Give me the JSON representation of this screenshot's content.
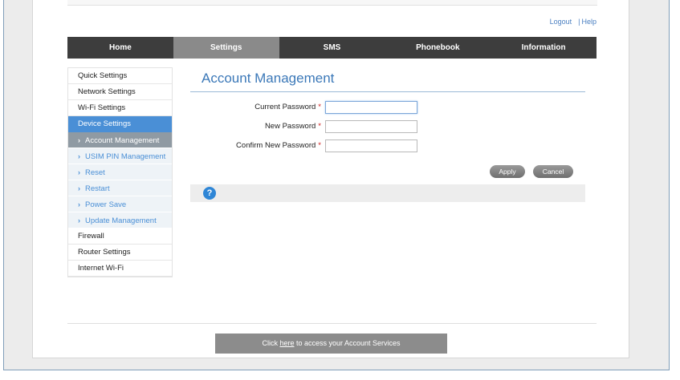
{
  "header": {
    "links": {
      "logout": "Logout",
      "separator": "|",
      "help": "Help"
    }
  },
  "nav": {
    "tabs": [
      {
        "label": "Home"
      },
      {
        "label": "Settings"
      },
      {
        "label": "SMS"
      },
      {
        "label": "Phonebook"
      },
      {
        "label": "Information"
      }
    ],
    "active_index": 1
  },
  "sidebar": {
    "items": [
      {
        "label": "Quick Settings"
      },
      {
        "label": "Network Settings"
      },
      {
        "label": "Wi-Fi Settings"
      },
      {
        "label": "Device Settings"
      },
      {
        "label": "Firewall"
      },
      {
        "label": "Router Settings"
      },
      {
        "label": "Internet Wi-Fi"
      }
    ],
    "chevron": "›",
    "subitems": [
      {
        "label": "Account Management"
      },
      {
        "label": "USIM PIN Management"
      },
      {
        "label": "Reset"
      },
      {
        "label": "Restart"
      },
      {
        "label": "Power Save"
      },
      {
        "label": "Update Management"
      }
    ]
  },
  "content": {
    "title": "Account Management",
    "required_mark": "*",
    "fields": [
      {
        "label": "Current Password",
        "value": ""
      },
      {
        "label": "New Password",
        "value": ""
      },
      {
        "label": "Confirm New Password",
        "value": ""
      }
    ],
    "buttons": {
      "apply": "Apply",
      "cancel": "Cancel"
    },
    "help_glyph": "?"
  },
  "footer": {
    "prefix": "Click ",
    "link": "here",
    "suffix": " to access your Account Services"
  },
  "colors": {
    "accent": "#4a8fd6",
    "nav_bg": "#3d3d3d",
    "nav_active": "#8a8a8a",
    "title": "#3b78b8"
  },
  "icons": [
    "help-icon",
    "chevron-right-icon"
  ]
}
